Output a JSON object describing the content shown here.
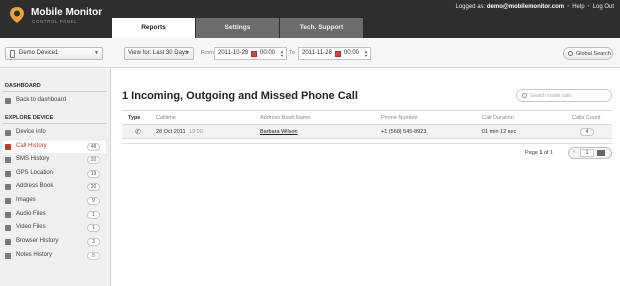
{
  "header": {
    "app_title": "Mobile Monitor",
    "app_subtitle": "CONTROL PANEL",
    "logged_prefix": "Logged as:",
    "logged_user": "demo@mobilemonitor.com",
    "help_label": "Help",
    "logout_label": "Log Out",
    "tabs": [
      {
        "label": "Reports",
        "active": true
      },
      {
        "label": "Settings",
        "active": false
      },
      {
        "label": "Tech. Support",
        "active": false
      }
    ]
  },
  "toolbar": {
    "device": "Demo Device1",
    "view_for": "View for: Last 30 Days",
    "from_label": "From",
    "from_date": "2011-10-28",
    "from_time": "00:00",
    "to_label": "To",
    "to_date": "2011-11-28",
    "to_time": "00:00",
    "global_search": "Global Search"
  },
  "sidebar": {
    "dashboard_heading": "DASHBOARD",
    "back_label": "Back to dashboard",
    "explore_heading": "EXPLORE DEVICE",
    "items": [
      {
        "label": "Device info",
        "count": null,
        "icon": "info-icon"
      },
      {
        "label": "Call History",
        "count": "48",
        "icon": "phone-icon",
        "active": true
      },
      {
        "label": "SMS History",
        "count": "20",
        "icon": "sms-icon"
      },
      {
        "label": "GPS Location",
        "count": "19",
        "icon": "gps-icon"
      },
      {
        "label": "Address Book",
        "count": "20",
        "icon": "address-book-icon"
      },
      {
        "label": "Images",
        "count": "9",
        "icon": "image-icon"
      },
      {
        "label": "Audio Files",
        "count": "1",
        "icon": "audio-icon"
      },
      {
        "label": "Video Files",
        "count": "1",
        "icon": "video-icon"
      },
      {
        "label": "Browser History",
        "count": "3",
        "icon": "browser-icon"
      },
      {
        "label": "Notes History",
        "count": "5",
        "icon": "notes-icon"
      }
    ]
  },
  "main": {
    "title": "1 Incoming, Outgoing and Missed Phone Call",
    "search_placeholder": "Search inside calls",
    "columns": [
      "Type",
      "Calltime",
      "Address Book Name",
      "Phone Number",
      "Call Duration",
      "Calls Count"
    ],
    "rows": [
      {
        "date": "28 Oct 2011",
        "time": "19:00",
        "name": "Barbara Wilson",
        "phone": "+1 (560) 545-8923",
        "duration": "01 min 12 sec",
        "count": "4"
      }
    ],
    "pager": {
      "prefix": "Page",
      "current": "1",
      "of": "of",
      "total": "1",
      "input": "1"
    }
  },
  "colors": {
    "accent": "#c0392b",
    "header_bg": "#2e2e2e"
  }
}
